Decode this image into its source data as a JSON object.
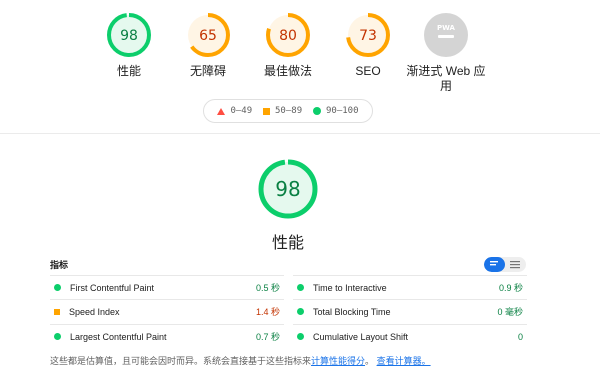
{
  "categories": [
    {
      "score": "98",
      "label": "性能",
      "status": "pass",
      "color": "#0cce6b",
      "text_color": "#0a8043",
      "fill": "#e5f9ee",
      "fraction": 0.98
    },
    {
      "score": "65",
      "label": "无障碍",
      "status": "average",
      "color": "#ffa400",
      "text_color": "#c33300",
      "fill": "#fff5e5",
      "fraction": 0.65
    },
    {
      "score": "80",
      "label": "最佳做法",
      "status": "average",
      "color": "#ffa400",
      "text_color": "#c33300",
      "fill": "#fff5e5",
      "fraction": 0.8
    },
    {
      "score": "73",
      "label": "SEO",
      "status": "average",
      "color": "#ffa400",
      "text_color": "#c33300",
      "fill": "#fff5e5",
      "fraction": 0.73
    },
    {
      "score": "PWA",
      "label": "渐进式 Web 应用",
      "status": "na",
      "color": "#d4d4d4",
      "icon": "pwa-icon"
    }
  ],
  "legend": {
    "fail": {
      "range": "0–49",
      "color": "#ff4e42",
      "icon": "triangle"
    },
    "average": {
      "range": "50–89",
      "color": "#ffa400",
      "icon": "square"
    },
    "pass": {
      "range": "90–100",
      "color": "#0cce6b",
      "icon": "circle"
    }
  },
  "performance": {
    "score": "98",
    "title": "性能",
    "fraction": 0.98
  },
  "metrics": {
    "header": "指标",
    "view_toggle": {
      "selected": "list",
      "icons": [
        "list-view-icon",
        "table-view-icon"
      ]
    },
    "left": [
      {
        "name": "First Contentful Paint",
        "value": "0.5 秒",
        "status": "pass"
      },
      {
        "name": "Speed Index",
        "value": "1.4 秒",
        "status": "average"
      },
      {
        "name": "Largest Contentful Paint",
        "value": "0.7 秒",
        "status": "pass"
      }
    ],
    "right": [
      {
        "name": "Time to Interactive",
        "value": "0.9 秒",
        "status": "pass"
      },
      {
        "name": "Total Blocking Time",
        "value": "0 毫秒",
        "status": "pass"
      },
      {
        "name": "Cumulative Layout Shift",
        "value": "0",
        "status": "pass"
      }
    ]
  },
  "footnote": {
    "text": "这些都是估算值，且可能会因时而异。系统会直接基于这些指标来",
    "link1": "计算性能得分",
    "sep": "。",
    "link2": "查看计算器。"
  }
}
